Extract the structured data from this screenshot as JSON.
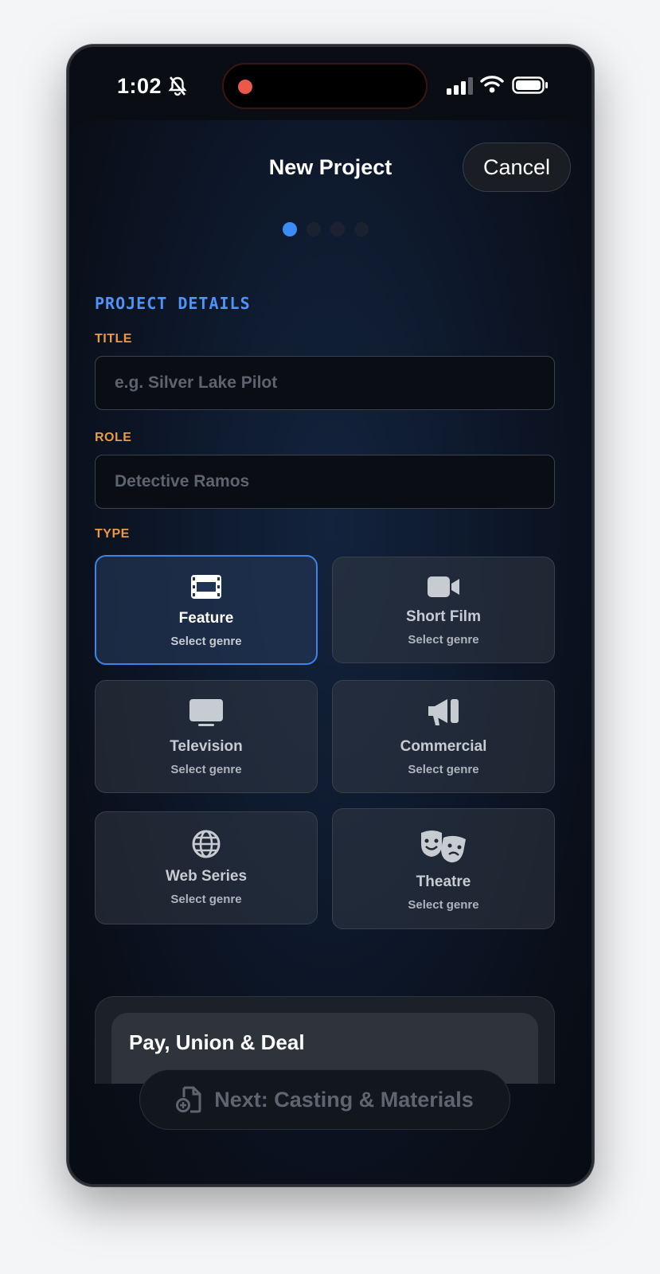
{
  "status_bar": {
    "time": "1:02"
  },
  "header": {
    "title": "New Project",
    "cancel_label": "Cancel"
  },
  "steps": {
    "total": 4,
    "current": 1
  },
  "form": {
    "section_title": "PROJECT DETAILS",
    "title_label": "TITLE",
    "title_placeholder": "e.g. Silver Lake Pilot",
    "role_label": "ROLE",
    "role_placeholder": "Detective Ramos",
    "type_label": "TYPE"
  },
  "types": [
    {
      "name": "Feature",
      "sub": "Select genre",
      "icon": "film-icon",
      "selected": true
    },
    {
      "name": "Short Film",
      "sub": "Select genre",
      "icon": "video-camera-icon",
      "selected": false
    },
    {
      "name": "Television",
      "sub": "Select genre",
      "icon": "tv-icon",
      "selected": false
    },
    {
      "name": "Commercial",
      "sub": "Select genre",
      "icon": "megaphone-icon",
      "selected": false
    },
    {
      "name": "Web Series",
      "sub": "Select genre",
      "icon": "globe-icon",
      "selected": false
    },
    {
      "name": "Theatre",
      "sub": "Select genre",
      "icon": "theater-masks-icon",
      "selected": false
    }
  ],
  "pay_section": {
    "title": "Pay, Union & Deal"
  },
  "next_button": {
    "label": "Next: Casting & Materials",
    "icon": "file-add-icon"
  },
  "colors": {
    "accent_blue": "#3b8cf5",
    "label_orange": "#e89a48",
    "recording_red": "#ea5a4b"
  }
}
